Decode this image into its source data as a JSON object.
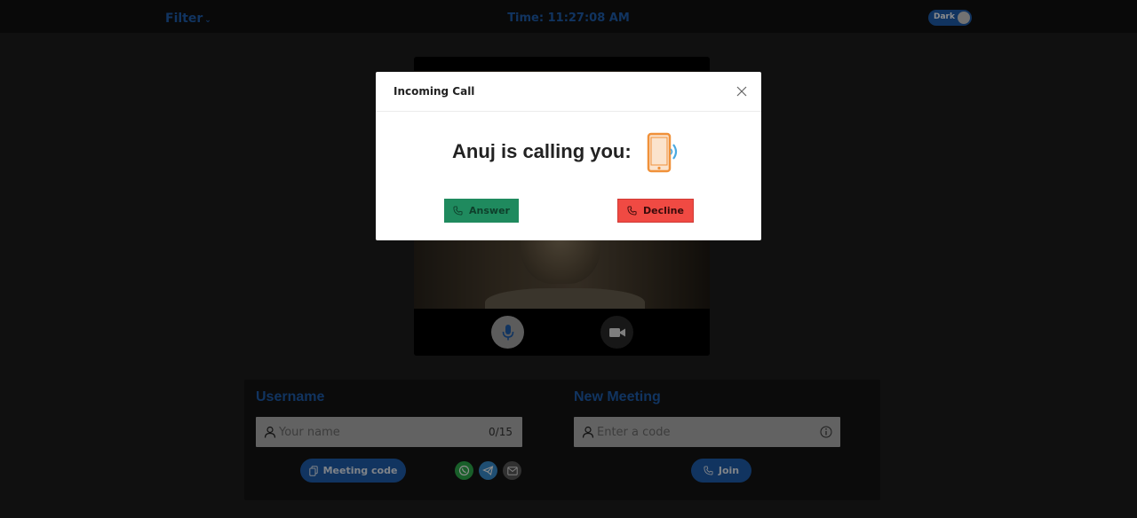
{
  "topbar": {
    "filter_label": "Filter",
    "time_text": "Time: 11:27:08 AM",
    "theme_toggle_label": "Dark"
  },
  "video": {
    "mic_icon": "microphone-icon",
    "camera_icon": "video-camera-icon"
  },
  "username_section": {
    "title": "Username",
    "placeholder": "Your name",
    "value": "",
    "counter": "0/15",
    "meeting_code_label": "Meeting code",
    "share_icons": [
      "whatsapp-icon",
      "telegram-icon",
      "email-icon"
    ]
  },
  "meeting_section": {
    "title": "New Meeting",
    "placeholder": "Enter a code",
    "value": "",
    "join_label": "Join"
  },
  "modal": {
    "title": "Incoming Call",
    "message": "Anuj is calling you:",
    "answer_label": "Answer",
    "decline_label": "Decline"
  },
  "colors": {
    "accent": "#1f5fb0",
    "answer": "#1f8a5e",
    "decline": "#f04a43",
    "phone": "#f0913a"
  }
}
